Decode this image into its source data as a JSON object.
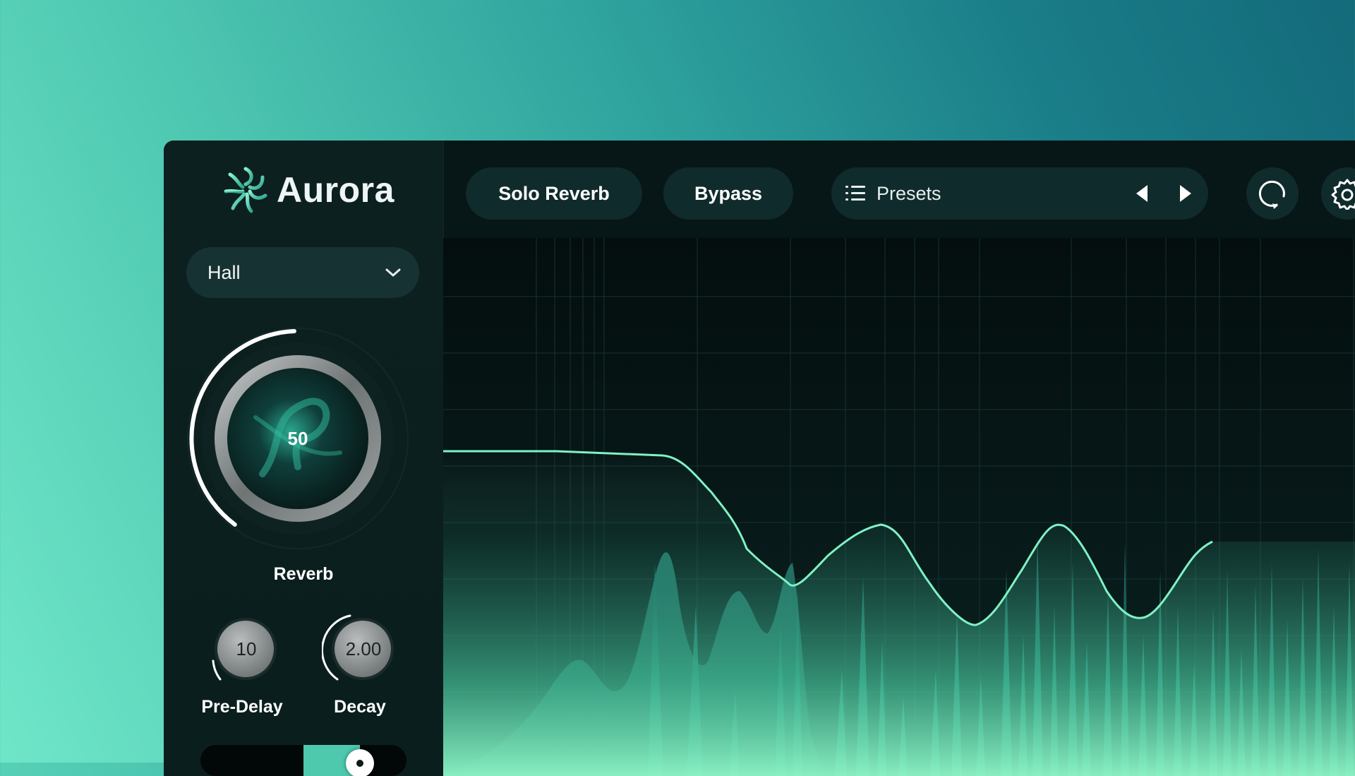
{
  "app": {
    "name": "Aurora"
  },
  "colors": {
    "accent": "#7ff2c4",
    "panel": "#071616",
    "pill": "#102b2b",
    "fill": "#4ec9ad"
  },
  "sidebar": {
    "mode": {
      "value": "Hall",
      "icon": "chevron-down-icon"
    },
    "reverb_knob": {
      "value": "50",
      "label": "Reverb",
      "level": 0.5
    },
    "predelay_knob": {
      "value": "10",
      "label": "Pre-Delay"
    },
    "decay_knob": {
      "value": "2.00",
      "label": "Decay"
    },
    "mix_slider": {
      "level": 0.76
    }
  },
  "toolbar": {
    "solo_label": "Solo Reverb",
    "bypass_label": "Bypass",
    "presets_label": "Presets",
    "icons": [
      "list-icon",
      "prev-preset-icon",
      "next-preset-icon",
      "loop-icon",
      "gear-icon"
    ]
  }
}
